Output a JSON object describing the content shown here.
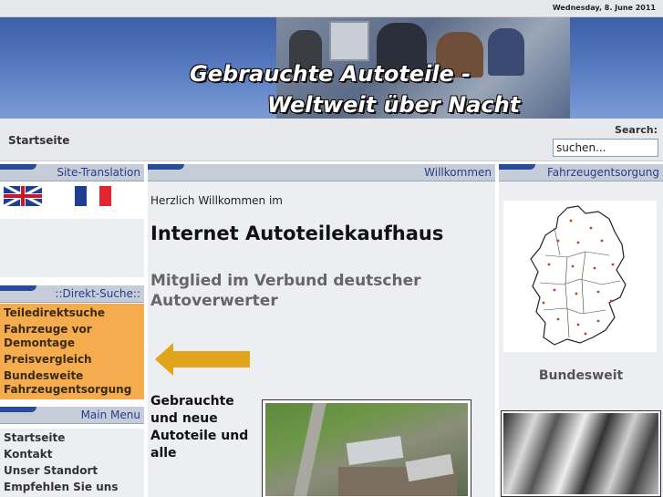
{
  "topbar": {
    "date": "Wednesday, 8. June 2011"
  },
  "banner": {
    "line1": "Gebrauchte Autoteile -",
    "line2": "Weltweit über Nacht"
  },
  "navbar": {
    "breadcrumb": "Startseite",
    "search_label": "Search:",
    "search_value": "suchen..."
  },
  "left": {
    "translation_header": "Site-Translation",
    "direct_search_header": "::Direkt-Suche::",
    "direct_search_items": [
      "Teiledirektsuche",
      "Fahrzeuge vor Demontage",
      "Preisvergleich",
      "Bundesweite Fahrzeugentsorgung"
    ],
    "main_menu_header": "Main Menu",
    "main_menu_items": [
      "Startseite",
      "Kontakt",
      "Unser Standort",
      "Empfehlen Sie uns"
    ]
  },
  "middle": {
    "header": "Willkommen",
    "welcome_small": "Herzlich Willkommen im",
    "headline": "Internet Autoteilekaufhaus",
    "subheadline": "Mitglied im Verbund deutscher Autoverwerter",
    "paragraph": "Gebrauchte und neue Autoteile und alle"
  },
  "right": {
    "header": "Fahrzeugentsorgung",
    "caption": "Bundesweit"
  },
  "colors": {
    "banner_blue": "#5577bd",
    "header_text": "#2a3b8f",
    "orange_box": "#f5ac4e",
    "arrow": "#e0a51a"
  }
}
